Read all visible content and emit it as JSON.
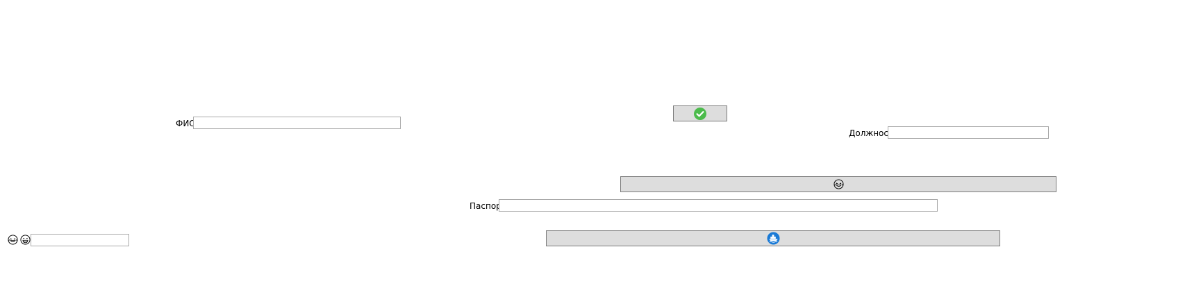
{
  "form": {
    "fio_label": "ФИО",
    "fio_value": "",
    "position_label": "Должность",
    "position_value": "",
    "passport_label": "Паспорт",
    "passport_value": "",
    "emoji_value": ""
  },
  "buttons": {
    "confirm_icon": "check-circle-icon",
    "emoji_icon": "laughing-emoji-icon",
    "ship_icon": "ship-icon"
  },
  "colors": {
    "button_bg": "#dddddd",
    "check_green": "#4cbb4c",
    "ship_blue": "#1a7ad6"
  }
}
